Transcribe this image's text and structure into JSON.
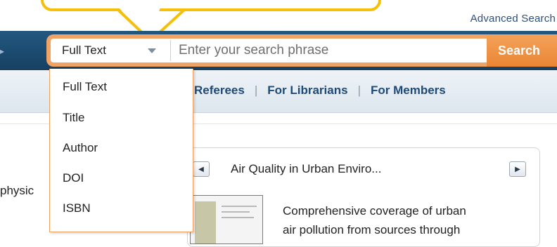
{
  "header": {
    "advanced_search": "Advanced Search"
  },
  "search": {
    "scope_selected": "Full Text",
    "placeholder": "Enter your search phrase",
    "button_label": "Search",
    "scope_options": [
      "Full Text",
      "Title",
      "Author",
      "DOI",
      "ISBN"
    ]
  },
  "subnav": {
    "items": [
      "Referees",
      "For Librarians",
      "For Members"
    ],
    "separator": "|"
  },
  "content": {
    "side_text": "physic"
  },
  "featured": {
    "title": "Air Quality in Urban Enviro...",
    "description_line1": "Comprehensive coverage of urban",
    "description_line2": "air pollution from sources through"
  },
  "colors": {
    "callout": "#f5bf0a",
    "header_blue": "#1c4b70",
    "search_orange": "#ea8634",
    "link_blue": "#1e4a78"
  },
  "icons": {
    "scope_caret": "caret-down-icon",
    "prev": "prev-arrow-icon",
    "next": "next-arrow-icon"
  }
}
